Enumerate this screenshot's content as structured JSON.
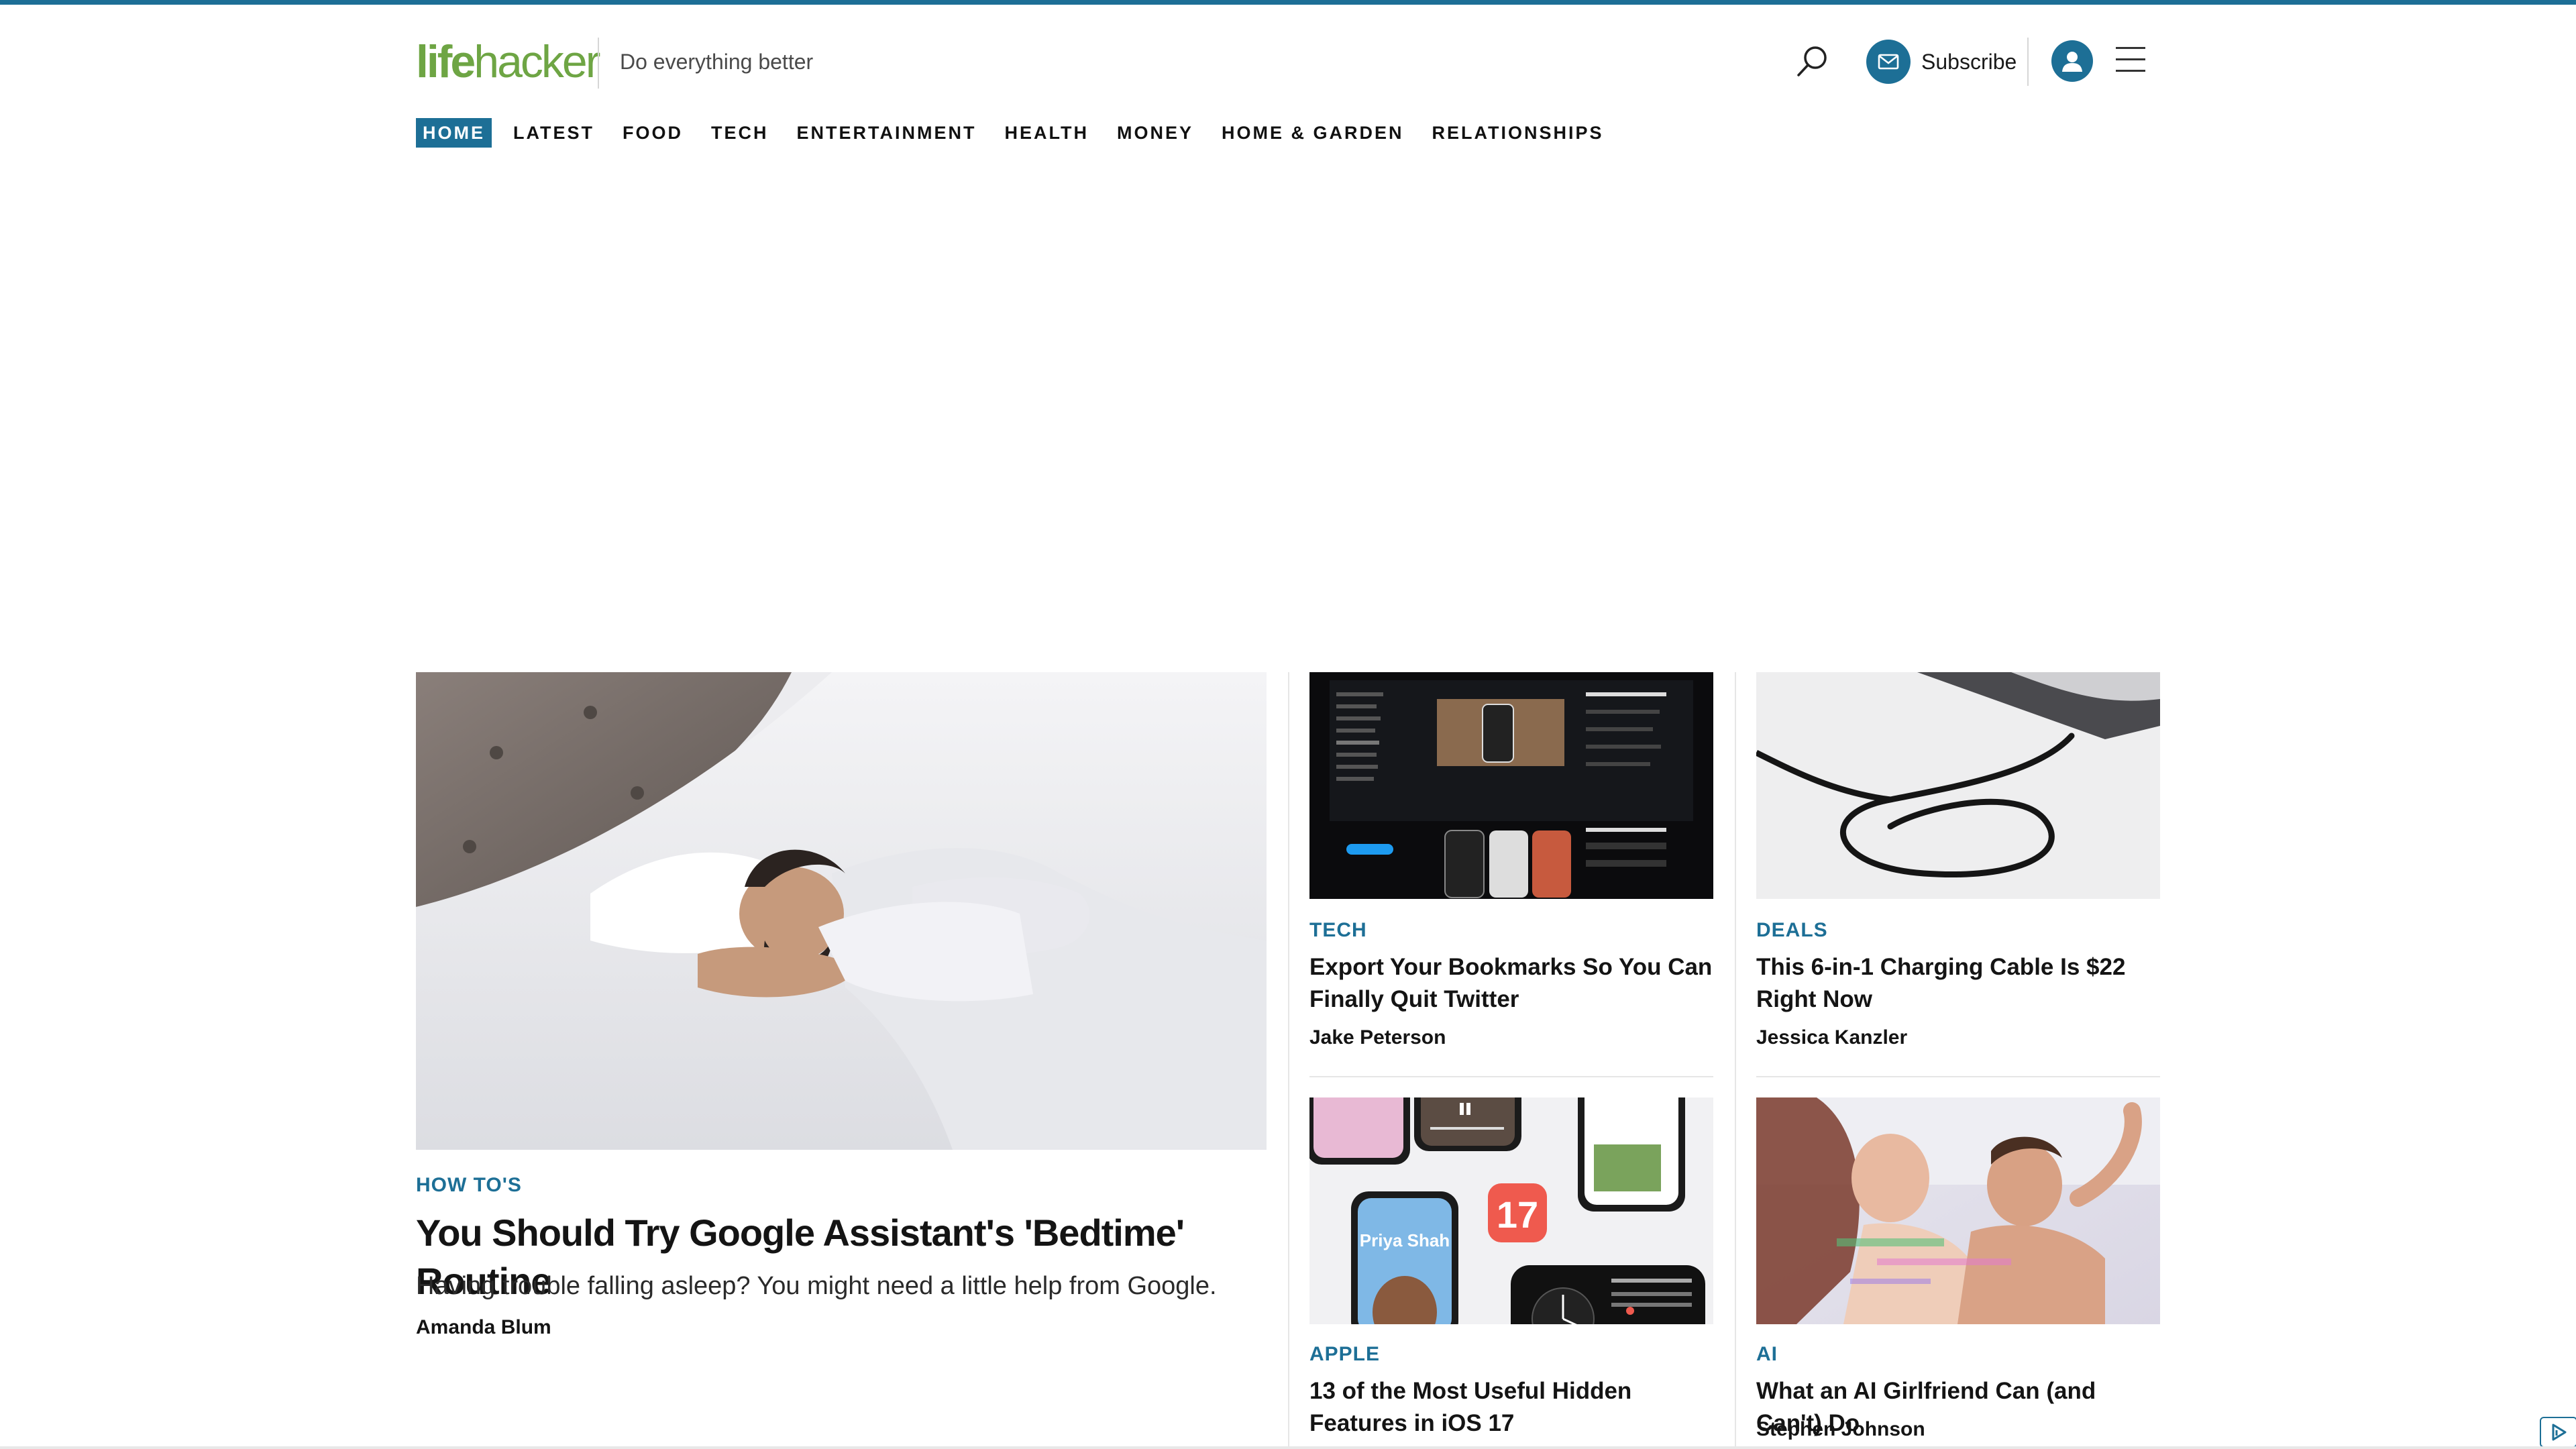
{
  "brand": {
    "logo_part1": "life",
    "logo_part2": "hacker",
    "tagline": "Do everything better"
  },
  "header": {
    "subscribe_label": "Subscribe"
  },
  "nav": [
    "HOME",
    "LATEST",
    "FOOD",
    "TECH",
    "ENTERTAINMENT",
    "HEALTH",
    "MONEY",
    "HOME & GARDEN",
    "RELATIONSHIPS"
  ],
  "nav_active": "HOME",
  "featured": {
    "category": "HOW TO'S",
    "title": "You Should Try Google Assistant's 'Bedtime' Routine",
    "description": "Having trouble falling asleep? You might need a little help from Google.",
    "author": "Amanda Blum"
  },
  "cards": [
    {
      "category": "TECH",
      "title": "Export Your Bookmarks So You Can Finally Quit Twitter",
      "author": "Jake Peterson"
    },
    {
      "category": "DEALS",
      "title": "This 6-in-1 Charging Cable Is $22 Right Now",
      "author": "Jessica Kanzler"
    },
    {
      "category": "APPLE",
      "title": "13 of the Most Useful Hidden Features in iOS 17",
      "author": ""
    },
    {
      "category": "AI",
      "title": "What an AI Girlfriend Can (and Can't) Do",
      "author": "Stephen Johnson"
    }
  ],
  "image_text": {
    "ios_number": "17",
    "phone_name": "Priya Shah"
  },
  "colors": {
    "accent": "#1d6f96",
    "logo_green": "#6ea544"
  }
}
